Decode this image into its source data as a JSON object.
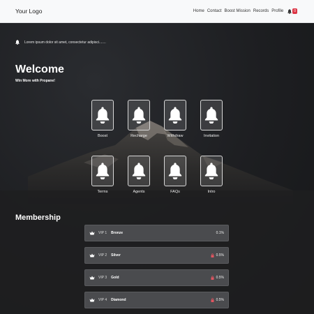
{
  "navbar": {
    "logo": "Your Logo",
    "links": [
      "Home",
      "Contact",
      "Boost Mission",
      "Records",
      "Profile"
    ],
    "notification_count": "0"
  },
  "hero": {
    "marquee_text": "Lorem ipsum dolor sit amet, consectetur adipisci.......",
    "title": "Welcome",
    "subtitle": "Win More with Propane!"
  },
  "tiles": [
    {
      "label": "Boost",
      "icon": "bell-icon"
    },
    {
      "label": "Recharge",
      "icon": "bell-icon"
    },
    {
      "label": "Withdraw",
      "icon": "bell-icon"
    },
    {
      "label": "Invitation",
      "icon": "bell-icon"
    },
    {
      "label": "Terms",
      "icon": "bell-icon"
    },
    {
      "label": "Agents",
      "icon": "bell-icon"
    },
    {
      "label": "FAQs",
      "icon": "bell-icon"
    },
    {
      "label": "Intro",
      "icon": "bell-icon"
    }
  ],
  "membership": {
    "title": "Membership",
    "levels": [
      {
        "level": "VIP 1",
        "name": "Bronze",
        "rate": "0.1%",
        "locked": false
      },
      {
        "level": "VIP 2",
        "name": "Silver",
        "rate": "0.5%",
        "locked": true
      },
      {
        "level": "VIP 3",
        "name": "Gold",
        "rate": "0.5%",
        "locked": true
      },
      {
        "level": "VIP 4",
        "name": "Diamond",
        "rate": "0.5%",
        "locked": true
      }
    ]
  },
  "colors": {
    "navbar_bg": "#f8f9fa",
    "badge": "#dc3545",
    "lock": "#e05560",
    "vip_row_bg": "#4a4b4e"
  }
}
